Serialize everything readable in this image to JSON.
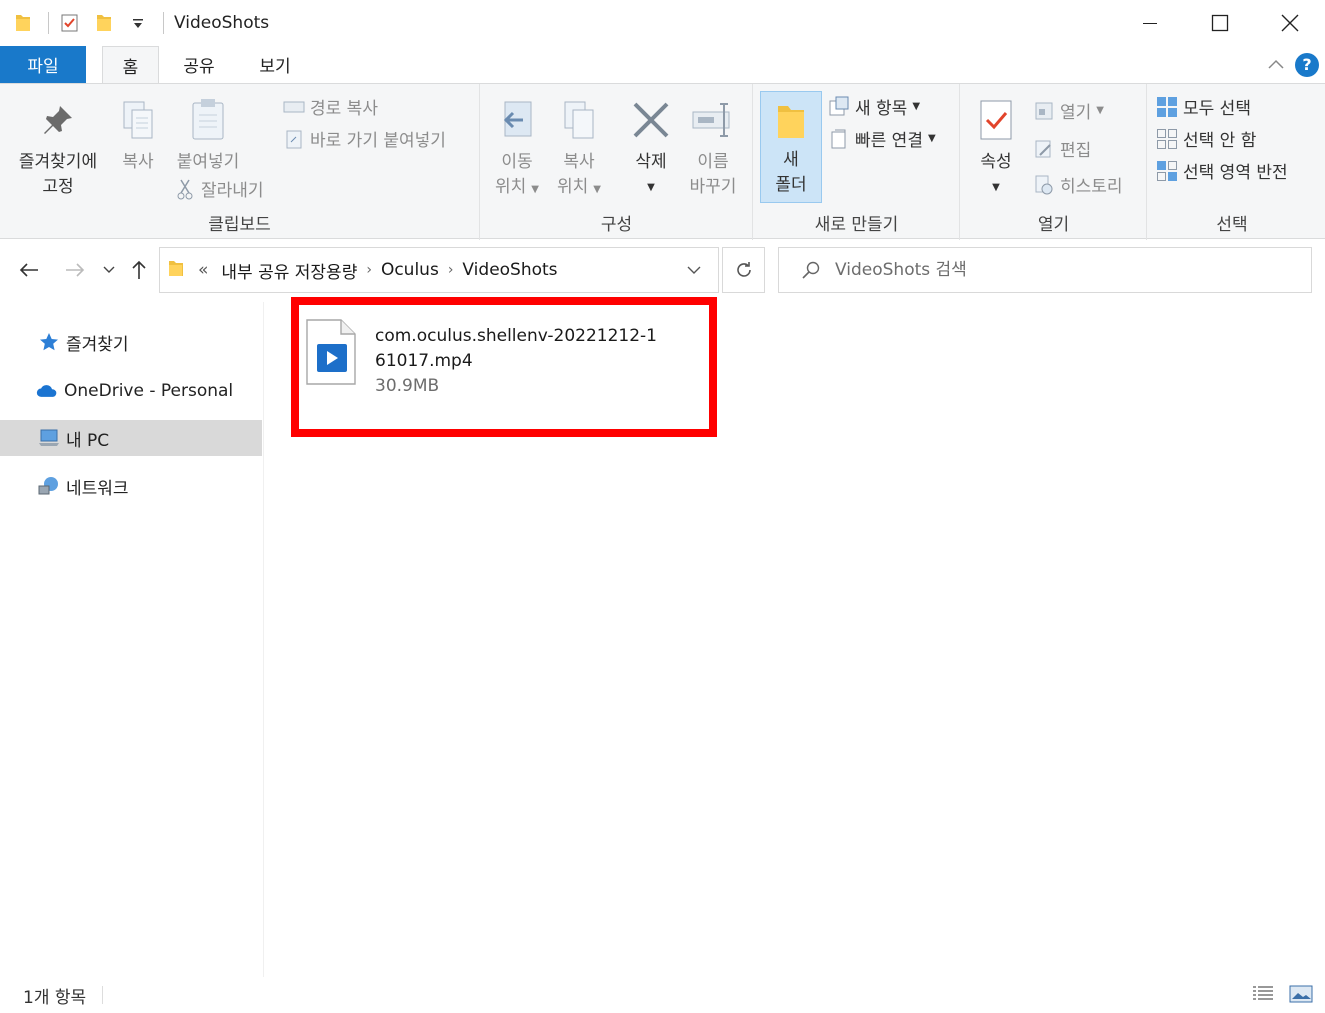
{
  "window": {
    "title": "VideoShots"
  },
  "tabs": [
    {
      "label": "파일"
    },
    {
      "label": "홈"
    },
    {
      "label": "공유"
    },
    {
      "label": "보기"
    }
  ],
  "ribbon": {
    "clipboard": {
      "label": "클립보드",
      "pin_line1": "즐겨찾기에",
      "pin_line2": "고정",
      "copy": "복사",
      "paste": "붙여넣기",
      "copy_path": "경로 복사",
      "paste_shortcut": "바로 가기 붙여넣기",
      "cut": "잘라내기"
    },
    "organize": {
      "label": "구성",
      "move_line1": "이동",
      "move_line2": "위치",
      "copyto_line1": "복사",
      "copyto_line2": "위치",
      "delete": "삭제",
      "rename_line1": "이름",
      "rename_line2": "바꾸기"
    },
    "new": {
      "label": "새로 만들기",
      "folder_line1": "새",
      "folder_line2": "폴더",
      "new_item": "새 항목",
      "easy_access": "빠른 연결"
    },
    "open": {
      "label": "열기",
      "properties": "속성",
      "open": "열기",
      "edit": "편집",
      "history": "히스토리"
    },
    "select": {
      "label": "선택",
      "select_all": "모두 선택",
      "select_none": "선택 안 함",
      "invert": "선택 영역 반전"
    }
  },
  "address": {
    "overflow": "«",
    "crumbs": [
      "내부 공유 저장용량",
      "Oculus",
      "VideoShots"
    ]
  },
  "search": {
    "placeholder": "VideoShots 검색"
  },
  "sidebar": {
    "items": [
      {
        "label": "즐겨찾기"
      },
      {
        "label": "OneDrive - Personal"
      },
      {
        "label": "내 PC"
      },
      {
        "label": "네트워크"
      }
    ]
  },
  "files": [
    {
      "name": "com.oculus.shellenv-20221212-161017.mp4",
      "size": "30.9MB"
    }
  ],
  "status": {
    "count": "1개 항목"
  },
  "colors": {
    "accent": "#1979ca",
    "highlight": "#ff0000",
    "selected_bg": "#d9d9d9"
  }
}
